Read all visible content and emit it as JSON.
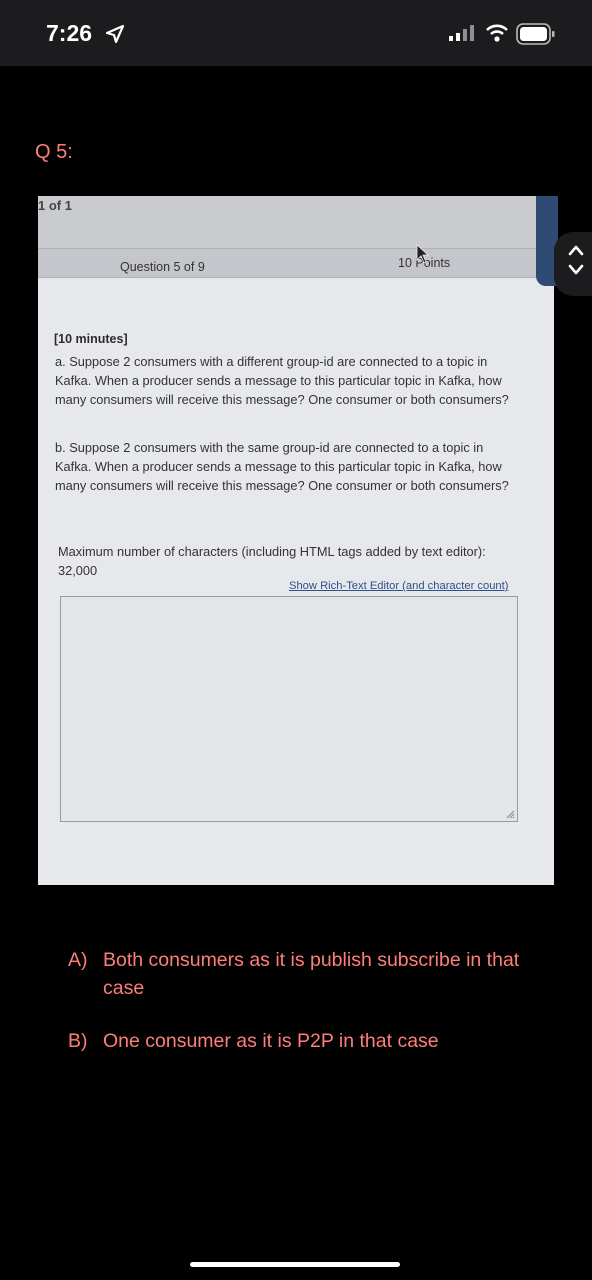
{
  "status_bar": {
    "time": "7:26"
  },
  "question_label": "Q 5:",
  "photo": {
    "page_count": "1 of 1",
    "question_number": "Question 5 of 9",
    "points": "10 Points",
    "time_limit": "[10 minutes]",
    "part_a": "a. Suppose 2 consumers with a different group-id are connected to a topic in Kafka. When a producer sends a message to this particular topic in Kafka, how many consumers will receive this message? One consumer or both consumers?",
    "part_b": "b. Suppose 2 consumers with the same group-id are connected to a topic in Kafka. When a producer sends a message to this particular topic in Kafka, how many consumers will receive this message? One consumer or both consumers?",
    "max_chars": "Maximum number of characters (including HTML tags added by text editor): 32,000",
    "rte_link": "Show Rich-Text Editor (and character count)"
  },
  "answers": [
    {
      "marker": "A)",
      "text": "Both consumers as it is publish subscribe in that case"
    },
    {
      "marker": "B)",
      "text": "One consumer as it is P2P in that case"
    }
  ],
  "colors": {
    "answer_text": "#ff7e79",
    "background": "#000000",
    "status_bar": "#1c1c1e"
  }
}
